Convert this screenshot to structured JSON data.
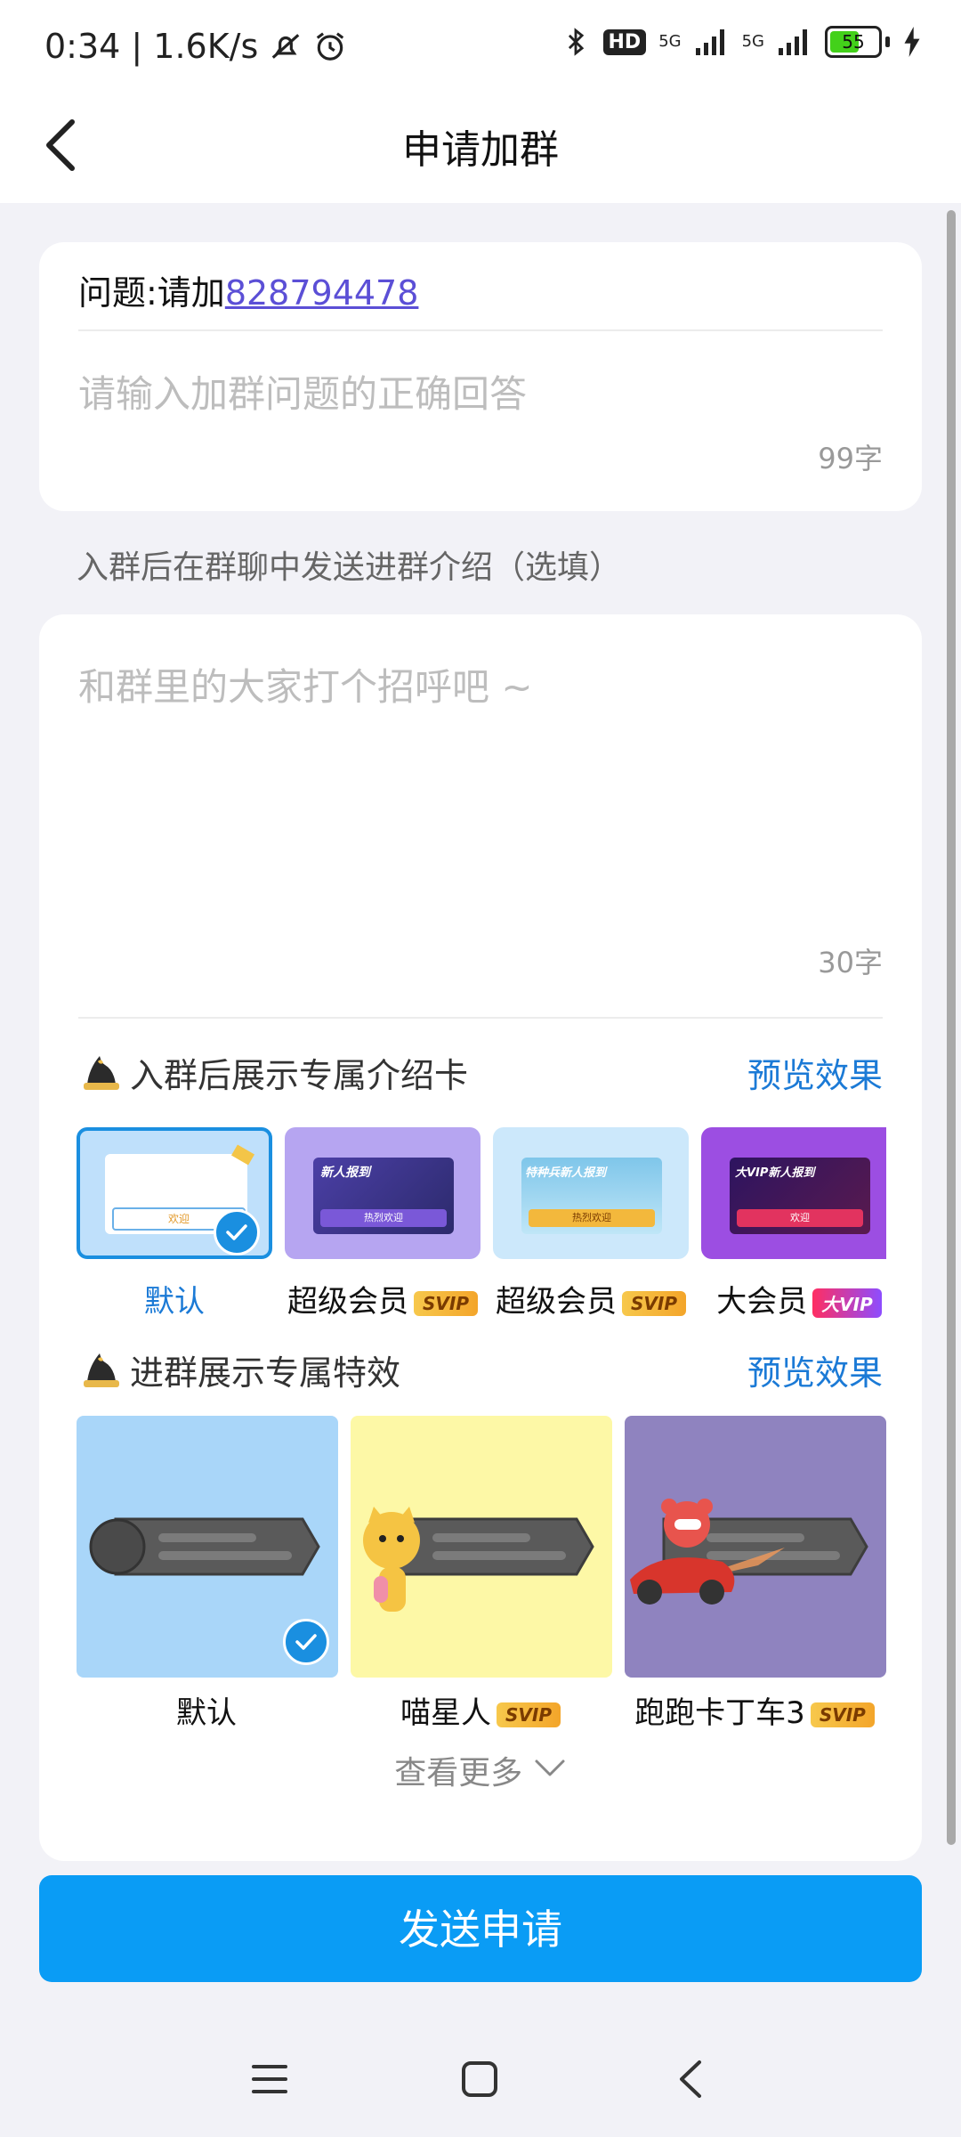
{
  "status_bar": {
    "time_speed": "0:34 | 1.6K/s",
    "hd": "HD",
    "net1": "5G",
    "net2": "5G",
    "battery": "55"
  },
  "header": {
    "title": "申请加群"
  },
  "question": {
    "prefix": "问题:请加",
    "link_text": "828794478",
    "answer_placeholder": "请输入加群问题的正确回答",
    "counter": "99字"
  },
  "intro": {
    "label": "入群后在群聊中发送进群介绍（选填）",
    "placeholder": "和群里的大家打个招呼吧 ~",
    "counter": "30字"
  },
  "intro_cards": {
    "title": "入群后展示专属介绍卡",
    "preview": "预览效果",
    "items": [
      {
        "label": "默认",
        "badge": "",
        "banner": "",
        "button": "欢迎"
      },
      {
        "label": "超级会员",
        "badge": "SVIP",
        "banner": "新人报到",
        "button": "热烈欢迎"
      },
      {
        "label": "超级会员",
        "badge": "SVIP",
        "banner": "特种兵新人报到",
        "button": "热烈欢迎"
      },
      {
        "label": "大会员",
        "badge": "大VIP",
        "banner": "大VIP新人报到",
        "button": "欢迎"
      }
    ]
  },
  "effects": {
    "title": "进群展示专属特效",
    "preview": "预览效果",
    "items": [
      {
        "label": "默认",
        "badge": ""
      },
      {
        "label": "喵星人",
        "badge": "SVIP"
      },
      {
        "label": "跑跑卡丁车3",
        "badge": "SVIP"
      }
    ],
    "more": "查看更多"
  },
  "actions": {
    "send": "发送申请"
  },
  "colors": {
    "accent": "#0a9cf5",
    "link": "#1b7ad6",
    "question_link": "#5b4fd6"
  }
}
